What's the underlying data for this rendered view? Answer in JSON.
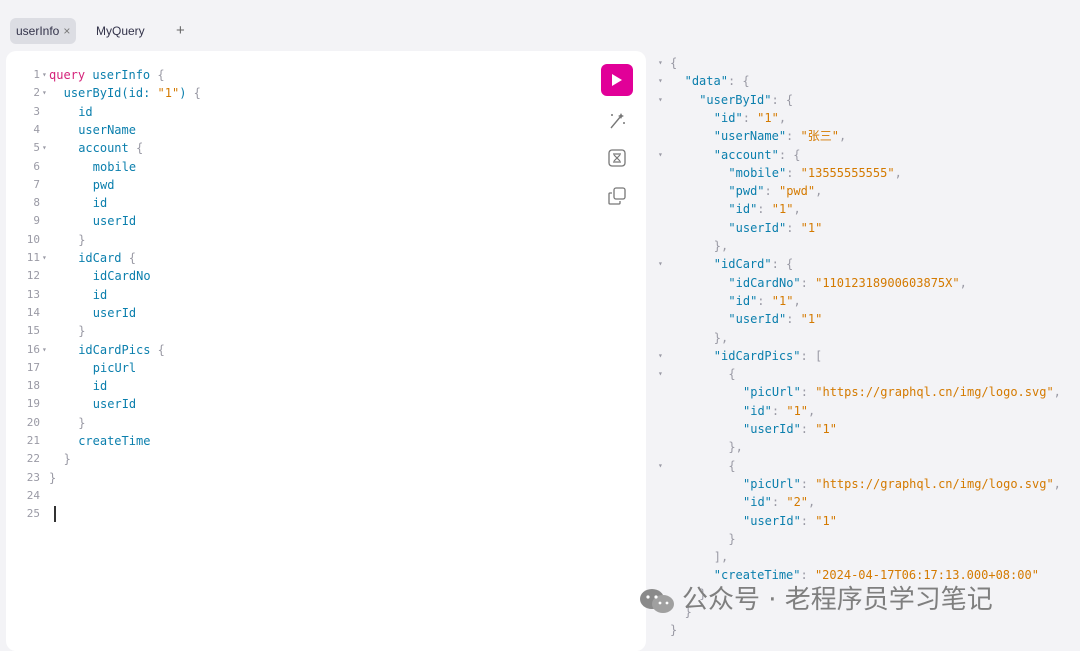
{
  "tabs": [
    {
      "label": "userInfo",
      "close": "×",
      "active": true
    },
    {
      "label": "MyQuery",
      "active": false
    }
  ],
  "add_tab": "+",
  "editor": {
    "lines": [
      {
        "n": "1",
        "fold": "▾",
        "t": [
          [
            "kw",
            "query"
          ],
          [
            "c",
            " userInfo "
          ],
          [
            "br",
            "{"
          ]
        ],
        "i": 0
      },
      {
        "n": "2",
        "fold": "▾",
        "t": [
          [
            "c",
            "userById(id: "
          ],
          [
            "str",
            "\"1\""
          ],
          [
            "c",
            ") "
          ],
          [
            "br",
            "{"
          ]
        ],
        "i": 1
      },
      {
        "n": "3",
        "fold": "",
        "t": [
          [
            "c",
            "id"
          ]
        ],
        "i": 2
      },
      {
        "n": "4",
        "fold": "",
        "t": [
          [
            "c",
            "userName"
          ]
        ],
        "i": 2
      },
      {
        "n": "5",
        "fold": "▾",
        "t": [
          [
            "c",
            "account "
          ],
          [
            "br",
            "{"
          ]
        ],
        "i": 2
      },
      {
        "n": "6",
        "fold": "",
        "t": [
          [
            "c",
            "mobile"
          ]
        ],
        "i": 3
      },
      {
        "n": "7",
        "fold": "",
        "t": [
          [
            "c",
            "pwd"
          ]
        ],
        "i": 3
      },
      {
        "n": "8",
        "fold": "",
        "t": [
          [
            "c",
            "id"
          ]
        ],
        "i": 3
      },
      {
        "n": "9",
        "fold": "",
        "t": [
          [
            "c",
            "userId"
          ]
        ],
        "i": 3
      },
      {
        "n": "10",
        "fold": "",
        "t": [
          [
            "br",
            "}"
          ]
        ],
        "i": 2
      },
      {
        "n": "11",
        "fold": "▾",
        "t": [
          [
            "c",
            "idCard "
          ],
          [
            "br",
            "{"
          ]
        ],
        "i": 2
      },
      {
        "n": "12",
        "fold": "",
        "t": [
          [
            "c",
            "idCardNo"
          ]
        ],
        "i": 3
      },
      {
        "n": "13",
        "fold": "",
        "t": [
          [
            "c",
            "id"
          ]
        ],
        "i": 3
      },
      {
        "n": "14",
        "fold": "",
        "t": [
          [
            "c",
            "userId"
          ]
        ],
        "i": 3
      },
      {
        "n": "15",
        "fold": "",
        "t": [
          [
            "br",
            "}"
          ]
        ],
        "i": 2
      },
      {
        "n": "16",
        "fold": "▾",
        "t": [
          [
            "c",
            "idCardPics "
          ],
          [
            "br",
            "{"
          ]
        ],
        "i": 2
      },
      {
        "n": "17",
        "fold": "",
        "t": [
          [
            "c",
            "picUrl"
          ]
        ],
        "i": 3
      },
      {
        "n": "18",
        "fold": "",
        "t": [
          [
            "c",
            "id"
          ]
        ],
        "i": 3
      },
      {
        "n": "19",
        "fold": "",
        "t": [
          [
            "c",
            "userId"
          ]
        ],
        "i": 3
      },
      {
        "n": "20",
        "fold": "",
        "t": [
          [
            "br",
            "}"
          ]
        ],
        "i": 2
      },
      {
        "n": "21",
        "fold": "",
        "t": [
          [
            "c",
            "createTime"
          ]
        ],
        "i": 2
      },
      {
        "n": "22",
        "fold": "",
        "t": [
          [
            "br",
            "}"
          ]
        ],
        "i": 1
      },
      {
        "n": "23",
        "fold": "",
        "t": [
          [
            "br",
            "}"
          ]
        ],
        "i": 0
      },
      {
        "n": "24",
        "fold": "",
        "t": [],
        "i": 0
      },
      {
        "n": "25",
        "fold": "",
        "t": [],
        "i": 0
      }
    ]
  },
  "toolbar": {
    "run": "play-icon",
    "prettify": "magic-wand-icon",
    "merge": "merge-fragments-icon",
    "copy": "copy-icon"
  },
  "result": {
    "lines": [
      {
        "f": "▾",
        "i": 0,
        "t": [
          [
            "p",
            "{"
          ]
        ]
      },
      {
        "f": "▾",
        "i": 1,
        "t": [
          [
            "k",
            "\"data\""
          ],
          [
            "p",
            ": {"
          ]
        ]
      },
      {
        "f": "▾",
        "i": 2,
        "t": [
          [
            "k",
            "\"userById\""
          ],
          [
            "p",
            ": {"
          ]
        ]
      },
      {
        "f": "",
        "i": 3,
        "t": [
          [
            "k",
            "\"id\""
          ],
          [
            "p",
            ": "
          ],
          [
            "v",
            "\"1\""
          ],
          [
            "p",
            ","
          ]
        ]
      },
      {
        "f": "",
        "i": 3,
        "t": [
          [
            "k",
            "\"userName\""
          ],
          [
            "p",
            ": "
          ],
          [
            "v",
            "\"张三\""
          ],
          [
            "p",
            ","
          ]
        ]
      },
      {
        "f": "▾",
        "i": 3,
        "t": [
          [
            "k",
            "\"account\""
          ],
          [
            "p",
            ": {"
          ]
        ]
      },
      {
        "f": "",
        "i": 4,
        "t": [
          [
            "k",
            "\"mobile\""
          ],
          [
            "p",
            ": "
          ],
          [
            "v",
            "\"13555555555\""
          ],
          [
            "p",
            ","
          ]
        ]
      },
      {
        "f": "",
        "i": 4,
        "t": [
          [
            "k",
            "\"pwd\""
          ],
          [
            "p",
            ": "
          ],
          [
            "v",
            "\"pwd\""
          ],
          [
            "p",
            ","
          ]
        ]
      },
      {
        "f": "",
        "i": 4,
        "t": [
          [
            "k",
            "\"id\""
          ],
          [
            "p",
            ": "
          ],
          [
            "v",
            "\"1\""
          ],
          [
            "p",
            ","
          ]
        ]
      },
      {
        "f": "",
        "i": 4,
        "t": [
          [
            "k",
            "\"userId\""
          ],
          [
            "p",
            ": "
          ],
          [
            "v",
            "\"1\""
          ]
        ]
      },
      {
        "f": "",
        "i": 3,
        "t": [
          [
            "p",
            "},"
          ]
        ]
      },
      {
        "f": "▾",
        "i": 3,
        "t": [
          [
            "k",
            "\"idCard\""
          ],
          [
            "p",
            ": {"
          ]
        ]
      },
      {
        "f": "",
        "i": 4,
        "t": [
          [
            "k",
            "\"idCardNo\""
          ],
          [
            "p",
            ": "
          ],
          [
            "v",
            "\"11012318900603875X\""
          ],
          [
            "p",
            ","
          ]
        ]
      },
      {
        "f": "",
        "i": 4,
        "t": [
          [
            "k",
            "\"id\""
          ],
          [
            "p",
            ": "
          ],
          [
            "v",
            "\"1\""
          ],
          [
            "p",
            ","
          ]
        ]
      },
      {
        "f": "",
        "i": 4,
        "t": [
          [
            "k",
            "\"userId\""
          ],
          [
            "p",
            ": "
          ],
          [
            "v",
            "\"1\""
          ]
        ]
      },
      {
        "f": "",
        "i": 3,
        "t": [
          [
            "p",
            "},"
          ]
        ]
      },
      {
        "f": "▾",
        "i": 3,
        "t": [
          [
            "k",
            "\"idCardPics\""
          ],
          [
            "p",
            ": ["
          ]
        ]
      },
      {
        "f": "▾",
        "i": 4,
        "t": [
          [
            "p",
            "{"
          ]
        ]
      },
      {
        "f": "",
        "i": 5,
        "t": [
          [
            "k",
            "\"picUrl\""
          ],
          [
            "p",
            ": "
          ],
          [
            "v",
            "\"https://graphql.cn/img/logo.svg\""
          ],
          [
            "p",
            ","
          ]
        ]
      },
      {
        "f": "",
        "i": 5,
        "t": [
          [
            "k",
            "\"id\""
          ],
          [
            "p",
            ": "
          ],
          [
            "v",
            "\"1\""
          ],
          [
            "p",
            ","
          ]
        ]
      },
      {
        "f": "",
        "i": 5,
        "t": [
          [
            "k",
            "\"userId\""
          ],
          [
            "p",
            ": "
          ],
          [
            "v",
            "\"1\""
          ]
        ]
      },
      {
        "f": "",
        "i": 4,
        "t": [
          [
            "p",
            "},"
          ]
        ]
      },
      {
        "f": "▾",
        "i": 4,
        "t": [
          [
            "p",
            "{"
          ]
        ]
      },
      {
        "f": "",
        "i": 5,
        "t": [
          [
            "k",
            "\"picUrl\""
          ],
          [
            "p",
            ": "
          ],
          [
            "v",
            "\"https://graphql.cn/img/logo.svg\""
          ],
          [
            "p",
            ","
          ]
        ]
      },
      {
        "f": "",
        "i": 5,
        "t": [
          [
            "k",
            "\"id\""
          ],
          [
            "p",
            ": "
          ],
          [
            "v",
            "\"2\""
          ],
          [
            "p",
            ","
          ]
        ]
      },
      {
        "f": "",
        "i": 5,
        "t": [
          [
            "k",
            "\"userId\""
          ],
          [
            "p",
            ": "
          ],
          [
            "v",
            "\"1\""
          ]
        ]
      },
      {
        "f": "",
        "i": 4,
        "t": [
          [
            "p",
            "}"
          ]
        ]
      },
      {
        "f": "",
        "i": 3,
        "t": [
          [
            "p",
            "],"
          ]
        ]
      },
      {
        "f": "",
        "i": 3,
        "t": [
          [
            "k",
            "\"createTime\""
          ],
          [
            "p",
            ": "
          ],
          [
            "v",
            "\"2024-04-17T06:17:13.000+08:00\""
          ]
        ]
      },
      {
        "f": "",
        "i": 2,
        "t": [
          [
            "p",
            "}"
          ]
        ]
      },
      {
        "f": "",
        "i": 1,
        "t": [
          [
            "p",
            "}"
          ]
        ]
      },
      {
        "f": "",
        "i": 0,
        "t": [
          [
            "p",
            "}"
          ]
        ]
      }
    ]
  },
  "watermark": {
    "text": "公众号 · 老程序员学习笔记",
    "icon": "wechat-icon"
  },
  "colors": {
    "accent": "#e10098",
    "key": "#0b7fad",
    "string": "#d47a00",
    "keyword": "#d4237a"
  }
}
